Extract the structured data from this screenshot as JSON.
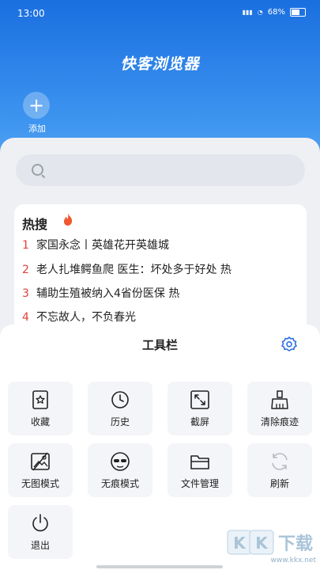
{
  "status_bar": {
    "time": "13:00",
    "battery": "68%"
  },
  "app": {
    "title": "快客浏览器",
    "add_label": "添加",
    "add_symbol": "+"
  },
  "hot_search": {
    "title": "热搜",
    "items": [
      {
        "rank": "1",
        "text": "家国永念丨英雄花开英雄城"
      },
      {
        "rank": "2",
        "text": "老人扎堆鳄鱼爬 医生：坏处多于好处  热"
      },
      {
        "rank": "3",
        "text": "辅助生殖被纳入4省份医保  热"
      },
      {
        "rank": "4",
        "text": "不忘故人，不负春光"
      }
    ]
  },
  "toolbar": {
    "title": "工具栏",
    "items": [
      {
        "label": "收藏",
        "icon": "bookmark-star-icon"
      },
      {
        "label": "历史",
        "icon": "clock-icon"
      },
      {
        "label": "截屏",
        "icon": "screenshot-icon"
      },
      {
        "label": "清除痕迹",
        "icon": "broom-icon"
      },
      {
        "label": "无图模式",
        "icon": "no-image-icon"
      },
      {
        "label": "无痕模式",
        "icon": "incognito-icon"
      },
      {
        "label": "文件管理",
        "icon": "folder-icon"
      },
      {
        "label": "刷新",
        "icon": "refresh-icon"
      },
      {
        "label": "退出",
        "icon": "power-icon"
      }
    ]
  },
  "watermark": {
    "url": "www.kkx.net",
    "logo": "KK下载"
  },
  "colors": {
    "accent": "#1a6fe0",
    "hot_rank": "#e3413a",
    "settings_icon": "#2f6fe0"
  }
}
